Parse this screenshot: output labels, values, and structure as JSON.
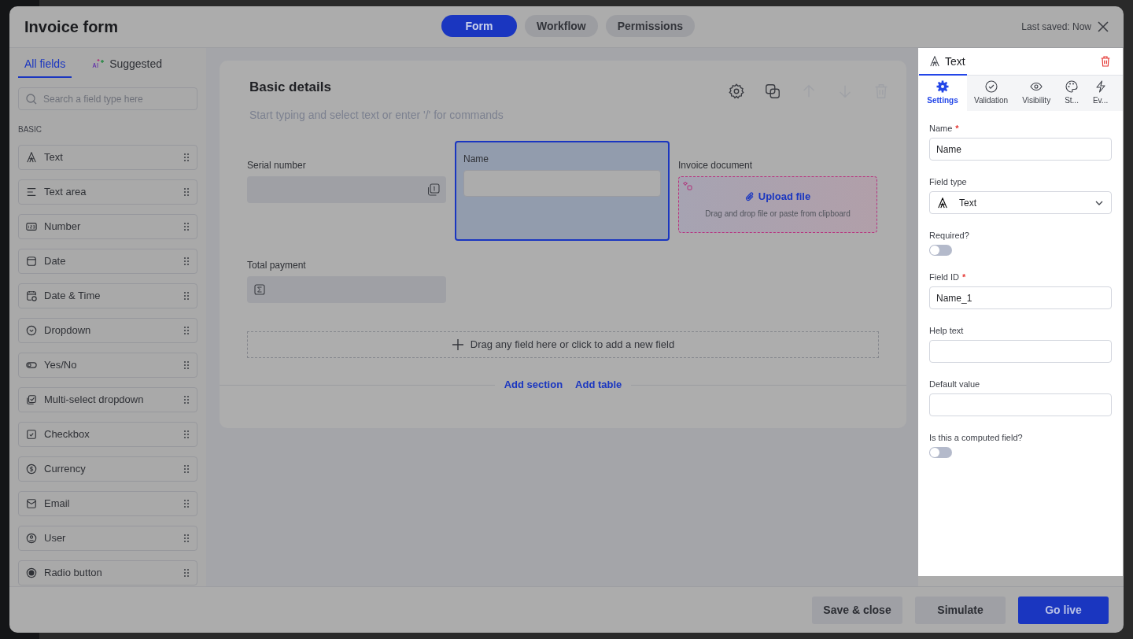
{
  "header": {
    "title": "Invoice form",
    "tabs": [
      {
        "label": "Form",
        "selected": true
      },
      {
        "label": "Workflow",
        "selected": false
      },
      {
        "label": "Permissions",
        "selected": false
      }
    ],
    "last_saved": "Last saved: Now"
  },
  "sidebar": {
    "tabs": [
      {
        "label": "All fields",
        "kind": "plain",
        "selected": true
      },
      {
        "label": "Suggested",
        "kind": "ai",
        "selected": false
      }
    ],
    "search": {
      "placeholder": "Search a field type here"
    },
    "section": "BASIC",
    "field_types": [
      {
        "label": "Text",
        "kind": "text"
      },
      {
        "label": "Text area",
        "kind": "textarea"
      },
      {
        "label": "Number",
        "kind": "number"
      },
      {
        "label": "Date",
        "kind": "date"
      },
      {
        "label": "Date & Time",
        "kind": "datetime"
      },
      {
        "label": "Dropdown",
        "kind": "dropdown"
      },
      {
        "label": "Yes/No",
        "kind": "yesno"
      },
      {
        "label": "Multi-select dropdown",
        "kind": "multiselect"
      },
      {
        "label": "Checkbox",
        "kind": "checkbox"
      },
      {
        "label": "Currency",
        "kind": "currency"
      },
      {
        "label": "Email",
        "kind": "email"
      },
      {
        "label": "User",
        "kind": "user"
      },
      {
        "label": "Radio button",
        "kind": "radio"
      }
    ]
  },
  "canvas": {
    "section": {
      "title": "Basic details",
      "description_placeholder": "Start typing and select text or enter '/' for commands",
      "fields": [
        {
          "label": "Serial number",
          "kind": "serial",
          "selected": false
        },
        {
          "label": "Name",
          "kind": "text",
          "selected": true
        },
        {
          "label": "Invoice document",
          "kind": "upload",
          "selected": false,
          "upload_label": "Upload file",
          "upload_hint": "Drag and drop file or paste from clipboard"
        },
        {
          "label": "Total payment",
          "kind": "computed",
          "selected": false
        }
      ],
      "drop_zone": "Drag any field here or click to add a new field",
      "actions": [
        "Add section",
        "Add table"
      ]
    }
  },
  "properties": {
    "title": "Text",
    "tabs": [
      {
        "label": "Settings",
        "kind": "settings",
        "selected": true
      },
      {
        "label": "Validation",
        "kind": "validation",
        "selected": false
      },
      {
        "label": "Visibility",
        "kind": "visibility",
        "selected": false
      },
      {
        "label": "St...",
        "kind": "style",
        "selected": false
      },
      {
        "label": "Ev...",
        "kind": "events",
        "selected": false
      }
    ],
    "fields": [
      {
        "label": "Name",
        "kind": "input",
        "required_mark": "*",
        "value": "Name"
      },
      {
        "label": "Field type",
        "kind": "select",
        "value": "Text"
      },
      {
        "label": "Required?",
        "kind": "toggle",
        "on": false
      },
      {
        "label": "Field ID",
        "kind": "input",
        "required_mark": "*",
        "value": "Name_1"
      },
      {
        "label": "Help text",
        "kind": "input"
      },
      {
        "label": "Default value",
        "kind": "input"
      },
      {
        "label": "Is this a computed field?",
        "kind": "toggle",
        "on": false
      }
    ]
  },
  "footer": {
    "buttons": [
      {
        "label": "Save & close",
        "kind": "secondary"
      },
      {
        "label": "Simulate",
        "kind": "secondary"
      },
      {
        "label": "Go live",
        "kind": "primary"
      }
    ]
  }
}
